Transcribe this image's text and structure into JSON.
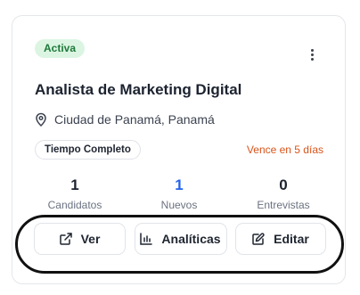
{
  "job": {
    "status": "Activa",
    "title": "Analista de Marketing Digital",
    "location": "Ciudad de Panamá, Panamá",
    "type": "Tiempo Completo",
    "expiry": "Vence en 5 días"
  },
  "stats": [
    {
      "value": "1",
      "label": "Candidatos"
    },
    {
      "value": "1",
      "label": "Nuevos"
    },
    {
      "value": "0",
      "label": "Entrevistas"
    }
  ],
  "actions": {
    "view_label": "Ver",
    "analytics_label": "Analíticas",
    "edit_label": "Editar"
  },
  "colors": {
    "status_bg": "#dcf5e3",
    "status_text": "#1f7a3a",
    "new_count": "#2563eb",
    "expiry": "#d9541a"
  },
  "icons": {
    "more": "more-vertical-icon",
    "location": "map-pin-icon",
    "view": "external-link-icon",
    "analytics": "bar-chart-icon",
    "edit": "edit-square-icon"
  }
}
